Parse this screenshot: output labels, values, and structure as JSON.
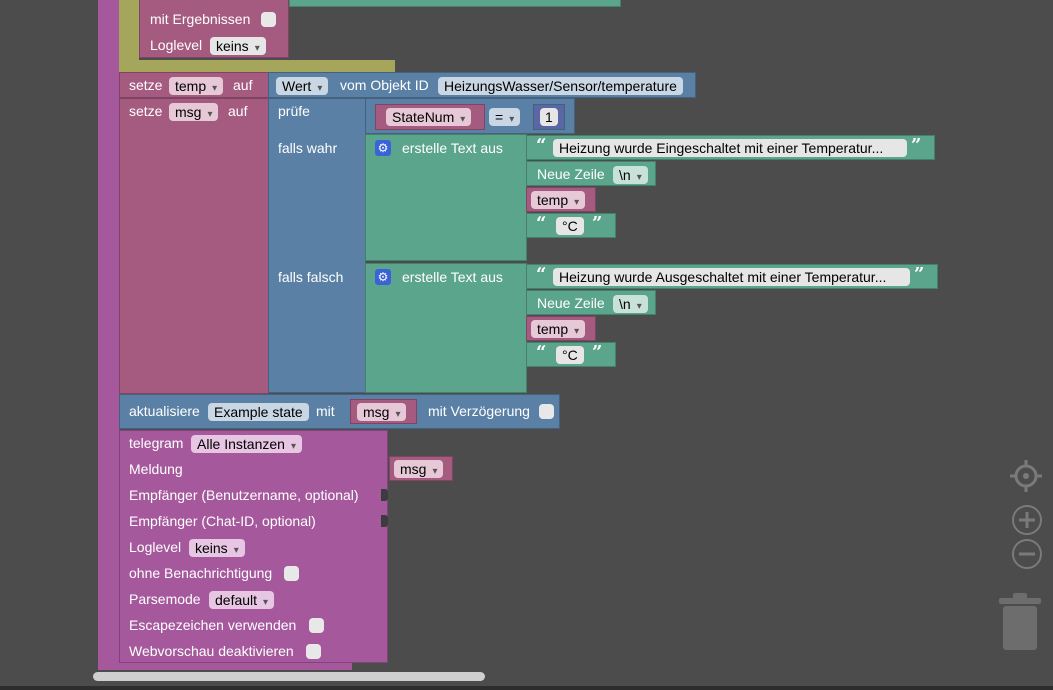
{
  "top_block": {
    "with_results_label": "mit Ergebnissen",
    "loglevel_label": "Loglevel",
    "loglevel_value": "keins"
  },
  "set_temp": {
    "setze": "setze",
    "var": "temp",
    "auf": "auf",
    "value_dropdown": "Wert",
    "from_object": "vom Objekt ID",
    "object_id": "HeizungsWasser/Sensor/temperature"
  },
  "set_msg": {
    "setze": "setze",
    "var": "msg",
    "auf": "auf",
    "pruefe": "prüfe",
    "condition_var": "StateNum",
    "operator": "=",
    "compare_value": "1",
    "falls_wahr": "falls wahr",
    "falls_falsch": "falls falsch",
    "create_text": "erstelle Text aus",
    "true_text": "Heizung wurde Eingeschaltet mit einer Temperatur...",
    "false_text": "Heizung wurde Ausgeschaltet mit einer Temperatur...",
    "new_line_label": "Neue Zeile",
    "new_line_value": "\\n",
    "temp_var": "temp",
    "unit": "°C"
  },
  "update_block": {
    "label": "aktualisiere",
    "state": "Example state",
    "mit": "mit",
    "var": "msg",
    "delay_label": "mit Verzögerung"
  },
  "telegram_block": {
    "telegram_label": "telegram",
    "instances": "Alle Instanzen",
    "meldung": "Meldung",
    "meldung_var": "msg",
    "recipient_user": "Empfänger (Benutzername, optional)",
    "recipient_chat": "Empfänger (Chat-ID, optional)",
    "loglevel_label": "Loglevel",
    "loglevel_value": "keins",
    "silent": "ohne Benachrichtigung",
    "parsemode_label": "Parsemode",
    "parsemode_value": "default",
    "escape": "Escapezeichen verwenden",
    "webpreview": "Webvorschau deaktivieren"
  },
  "workspace_controls": {
    "center": "crosshair-icon",
    "zoom_in": "plus-icon",
    "zoom_out": "minus-icon",
    "trash": "trash-icon"
  }
}
